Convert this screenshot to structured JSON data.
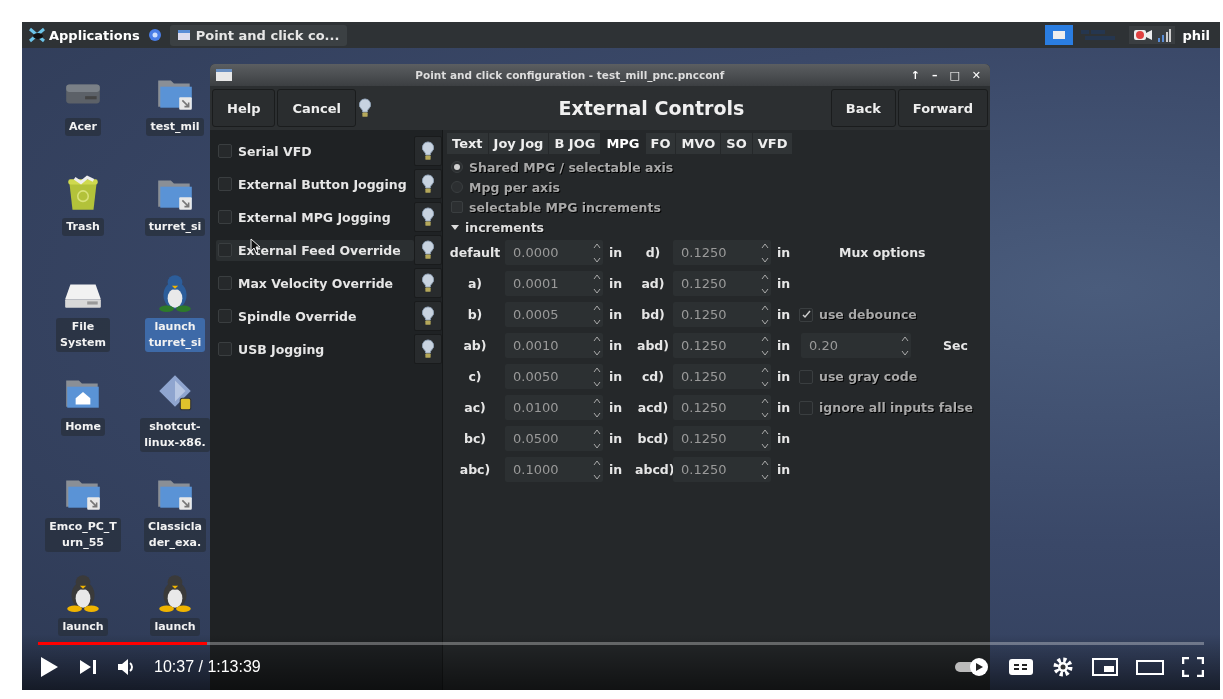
{
  "taskbar": {
    "menu": "Applications",
    "tasks": [
      {
        "label": "Point and click co...",
        "selected": true
      }
    ],
    "user": "phil"
  },
  "desktop_icons": [
    {
      "kind": "drive",
      "lines": [
        "Acer"
      ],
      "selected": false
    },
    {
      "kind": "folder",
      "lines": [
        "test_mil"
      ],
      "selected": false
    },
    {
      "kind": "trash",
      "lines": [
        "Trash"
      ],
      "selected": false
    },
    {
      "kind": "folder",
      "lines": [
        "turret_si"
      ],
      "selected": false
    },
    {
      "kind": "disk",
      "lines": [
        "File",
        "System"
      ],
      "selected": false
    },
    {
      "kind": "bluetux",
      "lines": [
        "launch",
        "turret_si"
      ],
      "selected": true
    },
    {
      "kind": "home",
      "lines": [
        "Home"
      ],
      "selected": false
    },
    {
      "kind": "package",
      "lines": [
        "shotcut-",
        "linux-x86."
      ],
      "selected": false
    },
    {
      "kind": "folder",
      "lines": [
        "Emco_PC_T",
        "urn_55"
      ],
      "selected": false
    },
    {
      "kind": "folder",
      "lines": [
        "Classicla",
        "der_exa."
      ],
      "selected": false
    },
    {
      "kind": "tux",
      "lines": [
        "launch"
      ],
      "selected": false
    },
    {
      "kind": "tux",
      "lines": [
        "launch"
      ],
      "selected": false
    }
  ],
  "dialog": {
    "title": "Point and click configuration - test_mill_pnc.pncconf",
    "window_buttons": [
      "↑",
      "–",
      "□",
      "✕"
    ],
    "header": {
      "left_buttons": [
        "Help",
        "Cancel"
      ],
      "heading": "External Controls",
      "right_buttons": [
        "Back",
        "Forward"
      ]
    },
    "options": [
      {
        "label": "Serial VFD",
        "checked": false,
        "highlighted": false
      },
      {
        "label": "External Button Jogging",
        "checked": false,
        "highlighted": false
      },
      {
        "label": "External MPG Jogging",
        "checked": false,
        "highlighted": false
      },
      {
        "label": "External Feed Override",
        "checked": false,
        "highlighted": true
      },
      {
        "label": "Max Velocity Override",
        "checked": false,
        "highlighted": false
      },
      {
        "label": "Spindle Override",
        "checked": false,
        "highlighted": false
      },
      {
        "label": "USB Jogging",
        "checked": false,
        "highlighted": false
      }
    ],
    "tabs": [
      {
        "label": "Text",
        "selected": false
      },
      {
        "label": "Joy Jog",
        "selected": false
      },
      {
        "label": "B JOG",
        "selected": false
      },
      {
        "label": "MPG",
        "selected": true
      },
      {
        "label": "FO",
        "selected": false
      },
      {
        "label": "MVO",
        "selected": false
      },
      {
        "label": "SO",
        "selected": false
      },
      {
        "label": "VFD",
        "selected": false
      }
    ],
    "mpg_mode": {
      "disabled": true,
      "options": [
        {
          "label": "Shared MPG / selectable axis",
          "selected": true
        },
        {
          "label": "Mpg per axis",
          "selected": false
        }
      ]
    },
    "selectable_increments": {
      "label": "selectable MPG increments",
      "checked": false,
      "disabled": true
    },
    "increments": {
      "label": "increments",
      "expanded": true,
      "rows": [
        {
          "label": "default",
          "value": "0.0000",
          "unit": "in",
          "label_2": "d)",
          "value_2": "0.1250",
          "unit_2": "in"
        },
        {
          "label": "a)",
          "value": "0.0001",
          "unit": "in",
          "label_2": "ad)",
          "value_2": "0.1250",
          "unit_2": "in"
        },
        {
          "label": "b)",
          "value": "0.0005",
          "unit": "in",
          "label_2": "bd)",
          "value_2": "0.1250",
          "unit_2": "in"
        },
        {
          "label": "ab)",
          "value": "0.0010",
          "unit": "in",
          "label_2": "abd)",
          "value_2": "0.1250",
          "unit_2": "in"
        },
        {
          "label": "c)",
          "value": "0.0050",
          "unit": "in",
          "label_2": "cd)",
          "value_2": "0.1250",
          "unit_2": "in"
        },
        {
          "label": "ac)",
          "value": "0.0100",
          "unit": "in",
          "label_2": "acd)",
          "value_2": "0.1250",
          "unit_2": "in"
        },
        {
          "label": "bc)",
          "value": "0.0500",
          "unit": "in",
          "label_2": "bcd)",
          "value_2": "0.1250",
          "unit_2": "in"
        },
        {
          "label": "abc)",
          "value": "0.1000",
          "unit": "in",
          "label_2": "abcd)",
          "value_2": "0.1250",
          "unit_2": "in"
        }
      ]
    },
    "mux": {
      "title": "Mux options",
      "debounce": {
        "label": "use debounce",
        "checked": true
      },
      "debounce_time": {
        "value": "0.20",
        "unit": "Sec"
      },
      "gray_code": {
        "label": "use gray code",
        "checked": false
      },
      "ignore_false": {
        "label": "ignore all inputs false",
        "checked": false
      }
    }
  },
  "player": {
    "progress": {
      "level": 0.145
    },
    "time": "10:37 / 1:13:39",
    "autoplay": {
      "on": true
    }
  }
}
